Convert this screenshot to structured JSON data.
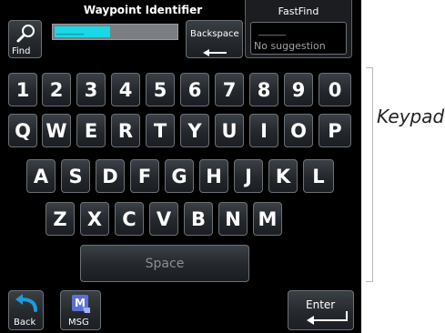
{
  "header": {
    "find_label": "Find",
    "title": "Waypoint Identifier",
    "identifier_placeholder": "______",
    "backspace_label": "Backspace"
  },
  "fastfind": {
    "title": "FastFind",
    "dashes": "______",
    "suggestion": "No suggestion"
  },
  "keypad": {
    "row1": [
      "1",
      "2",
      "3",
      "4",
      "5",
      "6",
      "7",
      "8",
      "9",
      "0"
    ],
    "row2": [
      "Q",
      "W",
      "E",
      "R",
      "T",
      "Y",
      "U",
      "I",
      "O",
      "P"
    ],
    "row3": [
      "A",
      "S",
      "D",
      "F",
      "G",
      "H",
      "J",
      "K",
      "L"
    ],
    "row4": [
      "Z",
      "X",
      "C",
      "V",
      "B",
      "N",
      "M"
    ],
    "space_label": "Space"
  },
  "bottom": {
    "back_label": "Back",
    "msg_label": "MSG",
    "enter_label": "Enter"
  },
  "annotation": {
    "keypad_label": "Keypad"
  },
  "colors": {
    "cursor": "#19d7e6",
    "key_border": "#6c7176",
    "back_arrow": "#1e9bd7",
    "msg_icon": "#5b6fd6"
  },
  "icons": {
    "find": "magnifier-icon",
    "backspace": "arrow-left-icon",
    "back": "curved-back-arrow-icon",
    "msg": "msg-icon",
    "enter": "enter-arrow-icon"
  }
}
